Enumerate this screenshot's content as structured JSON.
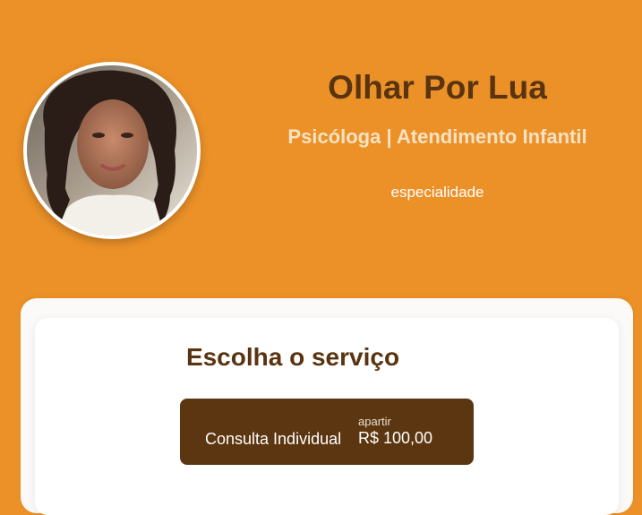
{
  "header": {
    "name": "Olhar Por Lua",
    "subtitle": "Psicóloga | Atendimento Infantil",
    "specialty": "especialidade"
  },
  "colors": {
    "background": "#ec9128",
    "primary_dark": "#5c3610",
    "subtitle": "#f7e2c2",
    "card": "#ffffff"
  },
  "services": {
    "title": "Escolha o serviço",
    "items": [
      {
        "name": "Consulta Individual",
        "price_label": "apartir",
        "price": "R$ 100,00"
      }
    ]
  }
}
